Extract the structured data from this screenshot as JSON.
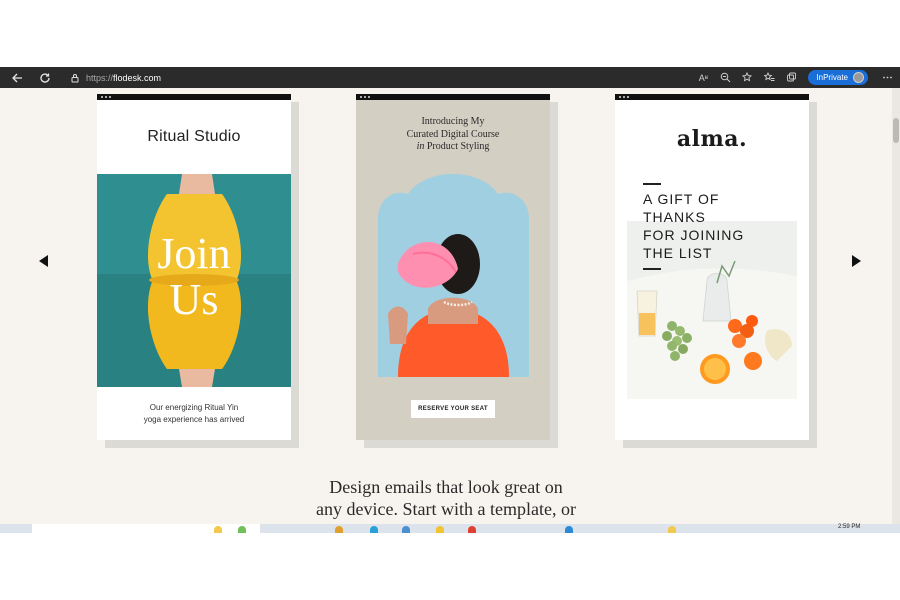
{
  "browser": {
    "url_protocol": "https://",
    "url_host": "flodesk.com",
    "inprivate_label": "InPrivate",
    "reader_icon_label": "Aʶ"
  },
  "cards": [
    {
      "title": "Ritual Studio",
      "image_text_line1": "Join",
      "image_text_line2": "Us",
      "caption_line1": "Our energizing Ritual Yin",
      "caption_line2": "yoga experience has arrived"
    },
    {
      "title_line1": "Introducing My",
      "title_line2": "Curated Digital Course",
      "title_line3_italic": "in",
      "title_line3_rest": " Product Styling",
      "button_label": "RESERVE YOUR SEAT",
      "background": "#d3cfc3"
    },
    {
      "logo": "alma.",
      "text_lines": [
        "A GIFT OF",
        "THANKS",
        "FOR JOINING",
        "THE LIST"
      ]
    }
  ],
  "headline_line1": "Design emails that look great on",
  "headline_line2": "any device. Start with a template, or",
  "taskbar": {
    "time": "2:59 PM"
  },
  "colors": {
    "page_bg": "#f7f4ef",
    "toolbar_bg": "#2b2b2b",
    "inprivate_bg": "#1a6ed8",
    "teal": "#2f8e8f",
    "yellow": "#f4c430",
    "sky": "#9fcfe0",
    "coral": "#ff5a2a"
  }
}
